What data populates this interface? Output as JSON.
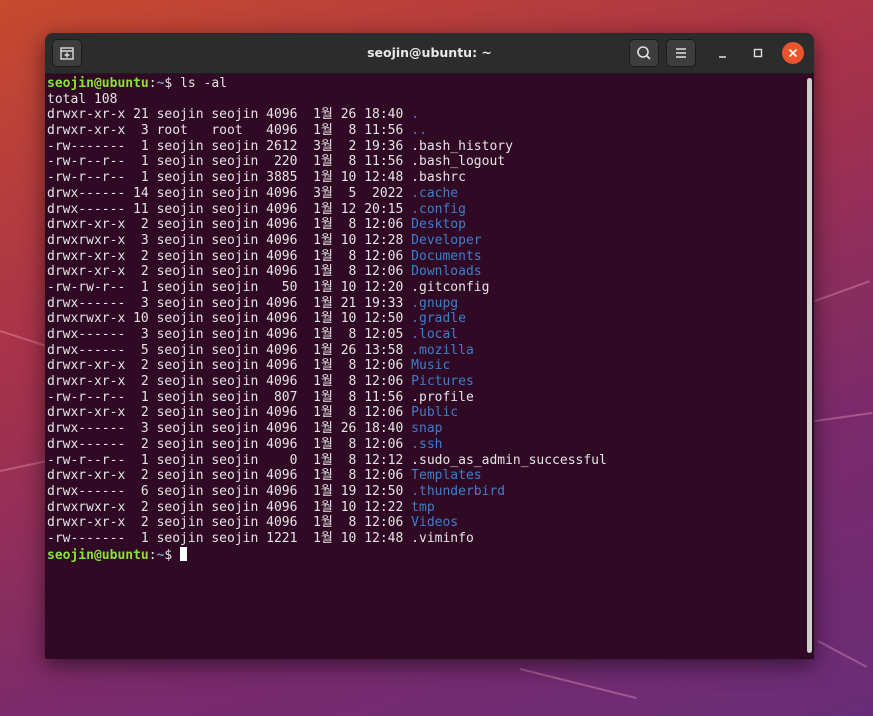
{
  "window": {
    "title": "seojin@ubuntu: ~"
  },
  "titlebar": {
    "new_tab_icon": "new-tab-icon",
    "search_icon": "search-icon",
    "menu_icon": "hamburger-menu-icon",
    "minimize_icon": "minimize-icon",
    "maximize_icon": "maximize-icon",
    "close_icon": "close-icon"
  },
  "prompt": {
    "user": "seojin@ubuntu",
    "colon": ":",
    "path": "~",
    "symbol": "$ "
  },
  "command": "ls -al",
  "total": "total 108",
  "entries": [
    {
      "meta": "drwxr-xr-x 21 seojin seojin 4096  1월 26 18:40 ",
      "name": ".",
      "is_dir": true
    },
    {
      "meta": "drwxr-xr-x  3 root   root   4096  1월  8 11:56 ",
      "name": "..",
      "is_dir": true
    },
    {
      "meta": "-rw-------  1 seojin seojin 2612  3월  2 19:36 ",
      "name": ".bash_history",
      "is_dir": false
    },
    {
      "meta": "-rw-r--r--  1 seojin seojin  220  1월  8 11:56 ",
      "name": ".bash_logout",
      "is_dir": false
    },
    {
      "meta": "-rw-r--r--  1 seojin seojin 3885  1월 10 12:48 ",
      "name": ".bashrc",
      "is_dir": false
    },
    {
      "meta": "drwx------ 14 seojin seojin 4096  3월  5  2022 ",
      "name": ".cache",
      "is_dir": true
    },
    {
      "meta": "drwx------ 11 seojin seojin 4096  1월 12 20:15 ",
      "name": ".config",
      "is_dir": true
    },
    {
      "meta": "drwxr-xr-x  2 seojin seojin 4096  1월  8 12:06 ",
      "name": "Desktop",
      "is_dir": true
    },
    {
      "meta": "drwxrwxr-x  3 seojin seojin 4096  1월 10 12:28 ",
      "name": "Developer",
      "is_dir": true
    },
    {
      "meta": "drwxr-xr-x  2 seojin seojin 4096  1월  8 12:06 ",
      "name": "Documents",
      "is_dir": true
    },
    {
      "meta": "drwxr-xr-x  2 seojin seojin 4096  1월  8 12:06 ",
      "name": "Downloads",
      "is_dir": true
    },
    {
      "meta": "-rw-rw-r--  1 seojin seojin   50  1월 10 12:20 ",
      "name": ".gitconfig",
      "is_dir": false
    },
    {
      "meta": "drwx------  3 seojin seojin 4096  1월 21 19:33 ",
      "name": ".gnupg",
      "is_dir": true
    },
    {
      "meta": "drwxrwxr-x 10 seojin seojin 4096  1월 10 12:50 ",
      "name": ".gradle",
      "is_dir": true
    },
    {
      "meta": "drwx------  3 seojin seojin 4096  1월  8 12:05 ",
      "name": ".local",
      "is_dir": true
    },
    {
      "meta": "drwx------  5 seojin seojin 4096  1월 26 13:58 ",
      "name": ".mozilla",
      "is_dir": true
    },
    {
      "meta": "drwxr-xr-x  2 seojin seojin 4096  1월  8 12:06 ",
      "name": "Music",
      "is_dir": true
    },
    {
      "meta": "drwxr-xr-x  2 seojin seojin 4096  1월  8 12:06 ",
      "name": "Pictures",
      "is_dir": true
    },
    {
      "meta": "-rw-r--r--  1 seojin seojin  807  1월  8 11:56 ",
      "name": ".profile",
      "is_dir": false
    },
    {
      "meta": "drwxr-xr-x  2 seojin seojin 4096  1월  8 12:06 ",
      "name": "Public",
      "is_dir": true
    },
    {
      "meta": "drwx------  3 seojin seojin 4096  1월 26 18:40 ",
      "name": "snap",
      "is_dir": true
    },
    {
      "meta": "drwx------  2 seojin seojin 4096  1월  8 12:06 ",
      "name": ".ssh",
      "is_dir": true
    },
    {
      "meta": "-rw-r--r--  1 seojin seojin    0  1월  8 12:12 ",
      "name": ".sudo_as_admin_successful",
      "is_dir": false
    },
    {
      "meta": "drwxr-xr-x  2 seojin seojin 4096  1월  8 12:06 ",
      "name": "Templates",
      "is_dir": true
    },
    {
      "meta": "drwx------  6 seojin seojin 4096  1월 19 12:50 ",
      "name": ".thunderbird",
      "is_dir": true
    },
    {
      "meta": "drwxrwxr-x  2 seojin seojin 4096  1월 10 12:22 ",
      "name": "tmp",
      "is_dir": true
    },
    {
      "meta": "drwxr-xr-x  2 seojin seojin 4096  1월  8 12:06 ",
      "name": "Videos",
      "is_dir": true
    },
    {
      "meta": "-rw-------  1 seojin seojin 1221  1월 10 12:48 ",
      "name": ".viminfo",
      "is_dir": false
    }
  ],
  "colors": {
    "background": "#300a24",
    "text": "#e4e4e4",
    "prompt_user": "#8ae234",
    "prompt_path": "#729fcf",
    "directory": "#3f7ec9",
    "close_button": "#e9542c"
  }
}
